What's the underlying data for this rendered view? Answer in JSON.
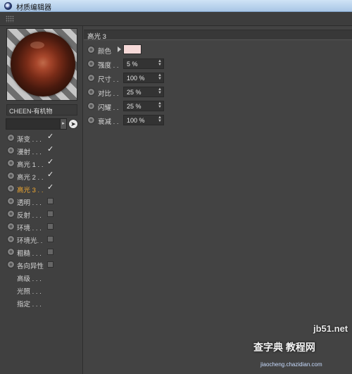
{
  "window": {
    "title": "材质编辑器"
  },
  "material": {
    "name": "CHEEN-有机物"
  },
  "channels": [
    {
      "label": "渐变 . . .",
      "checked": true
    },
    {
      "label": "漫射 . . .",
      "checked": true
    },
    {
      "label": "高光 1 . .",
      "checked": true
    },
    {
      "label": "高光 2 . .",
      "checked": true
    },
    {
      "label": "高光 3 . .",
      "checked": true,
      "active": true
    },
    {
      "label": "透明 . . .",
      "checked": false
    },
    {
      "label": "反射 . . .",
      "checked": false
    },
    {
      "label": "环境 . . .",
      "checked": false
    },
    {
      "label": "环境光. .",
      "checked": false
    },
    {
      "label": "粗糙 . . .",
      "checked": false
    },
    {
      "label": "各向异性",
      "checked": false
    }
  ],
  "extra_items": [
    "高级 . . .",
    "光照 . . .",
    "指定 . . ."
  ],
  "section": {
    "title": "高光 3"
  },
  "properties": [
    {
      "label": "颜色",
      "type": "color",
      "color": "#f6d9d8"
    },
    {
      "label": "强度 . .",
      "value": "5 %"
    },
    {
      "label": "尺寸 . .",
      "value": "100 %"
    },
    {
      "label": "对比 . .",
      "value": "25 %"
    },
    {
      "label": "闪耀 . .",
      "value": "25 %"
    },
    {
      "label": "衰减 . .",
      "value": "100 %"
    }
  ],
  "watermark": {
    "line1": "jb51.net",
    "line2": "查字典 教程网",
    "line3": "jiaocheng.chazidian.com"
  },
  "colors": {
    "active": "#f0a830",
    "panel": "#434343",
    "titlebar": "#bcd4ee"
  }
}
